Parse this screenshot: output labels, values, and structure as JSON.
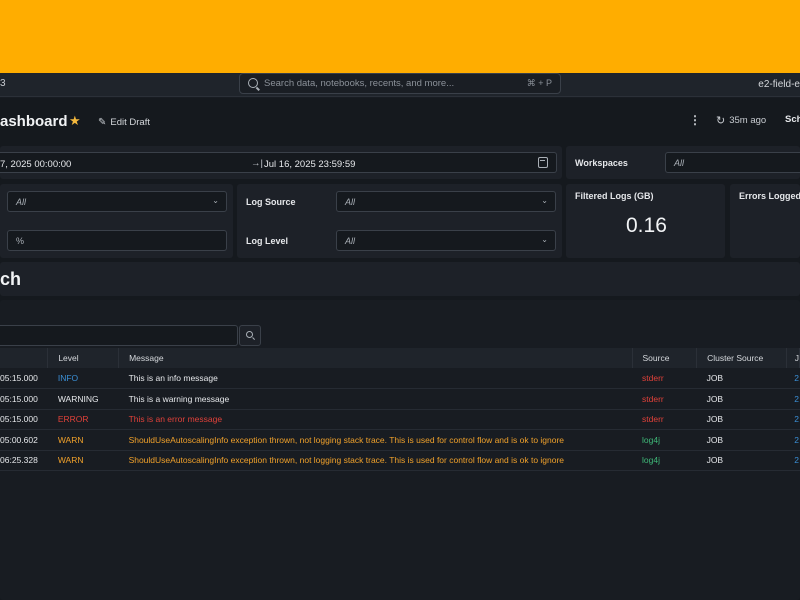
{
  "topbar": {
    "app_glyph": "3",
    "search_placeholder": "Search data, notebooks, recents, and more...",
    "search_shortcut": "⌘ + P",
    "workspace": "e2-field-e"
  },
  "header": {
    "title": "ashboard",
    "edit_draft_label": "Edit Draft",
    "refresh_label": "35m ago",
    "schedule_label": "Sch"
  },
  "filters": {
    "date_start": "7, 2025 00:00:00",
    "date_arrow": "→|",
    "date_end": "Jul 16, 2025 23:59:59",
    "workspaces_label": "Workspaces",
    "workspaces_value": "All",
    "filter1_value": "All",
    "log_source_label": "Log Source",
    "log_source_value": "All",
    "filter2_value": "%",
    "log_level_label": "Log Level",
    "log_level_value": "All"
  },
  "metrics": {
    "filtered_logs_title": "Filtered Logs (GB)",
    "filtered_logs_value": "0.16",
    "errors_logged_title": "Errors Logged"
  },
  "section": {
    "title": "ch"
  },
  "table": {
    "headers": [
      "",
      "Level",
      "Message",
      "Source",
      "Cluster Source",
      "J"
    ],
    "rows": [
      {
        "time": "05:15.000",
        "level": "INFO",
        "level_class": "info",
        "message": "This is an info message",
        "source": "stderr",
        "cluster": "JOB",
        "link": "2"
      },
      {
        "time": "05:15.000",
        "level": "WARNING",
        "level_class": "warning",
        "message": "This is a warning message",
        "source": "stderr",
        "cluster": "JOB",
        "link": "2"
      },
      {
        "time": "05:15.000",
        "level": "ERROR",
        "level_class": "error",
        "message": "This is an error message",
        "source": "stderr",
        "cluster": "JOB",
        "link": "2"
      },
      {
        "time": "05:00.602",
        "level": "WARN",
        "level_class": "warn",
        "message": "ShouldUseAutoscalingInfo exception thrown, not logging stack trace. This is used for control flow and is ok to ignore",
        "source": "log4j",
        "cluster": "JOB",
        "link": "2"
      },
      {
        "time": "06:25.328",
        "level": "WARN",
        "level_class": "warn",
        "message": "ShouldUseAutoscalingInfo exception thrown, not logging stack trace. This is used for control flow and is ok to ignore",
        "source": "log4j",
        "cluster": "JOB",
        "link": "2"
      }
    ]
  },
  "colors": {
    "banner": "#ffad00",
    "info": "#3a8fd6",
    "error": "#e0413a",
    "warn": "#f0a12b",
    "log4j": "#3fb878",
    "star": "#f5b93d"
  },
  "icons": [
    "search-icon",
    "star-icon",
    "pencil-icon",
    "kebab-icon",
    "refresh-icon",
    "calendar-icon",
    "chevron-down-icon"
  ]
}
